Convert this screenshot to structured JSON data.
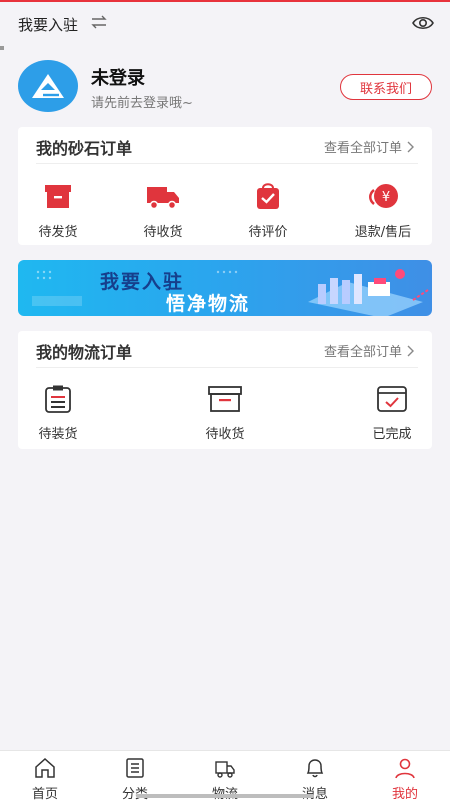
{
  "topbar": {
    "title": "我要入驻"
  },
  "profile": {
    "name": "未登录",
    "subtitle": "请先前去登录哦~",
    "contact_label": "联系我们"
  },
  "sand_orders": {
    "title": "我的砂石订单",
    "view_all": "查看全部订单",
    "items": [
      {
        "label": "待发货",
        "icon": "box-icon"
      },
      {
        "label": "待收货",
        "icon": "truck-icon"
      },
      {
        "label": "待评价",
        "icon": "review-bag-icon"
      },
      {
        "label": "退款/售后",
        "icon": "refund-icon"
      }
    ]
  },
  "banner": {
    "line1": "我要入驻",
    "line2": "悟净物流"
  },
  "logistics_orders": {
    "title": "我的物流订单",
    "view_all": "查看全部订单",
    "items": [
      {
        "label": "待装货",
        "icon": "clipboard-icon"
      },
      {
        "label": "待收货",
        "icon": "box-outline-icon"
      },
      {
        "label": "已完成",
        "icon": "checked-box-icon"
      }
    ]
  },
  "tabbar": {
    "items": [
      {
        "label": "首页",
        "icon": "home-icon"
      },
      {
        "label": "分类",
        "icon": "list-icon"
      },
      {
        "label": "物流",
        "icon": "truck-icon"
      },
      {
        "label": "消息",
        "icon": "bell-icon"
      },
      {
        "label": "我的",
        "icon": "user-icon",
        "active": true
      }
    ]
  },
  "colors": {
    "accent": "#e0353d",
    "avatar": "#2d9ee8",
    "banner": "#2aa6ee"
  }
}
